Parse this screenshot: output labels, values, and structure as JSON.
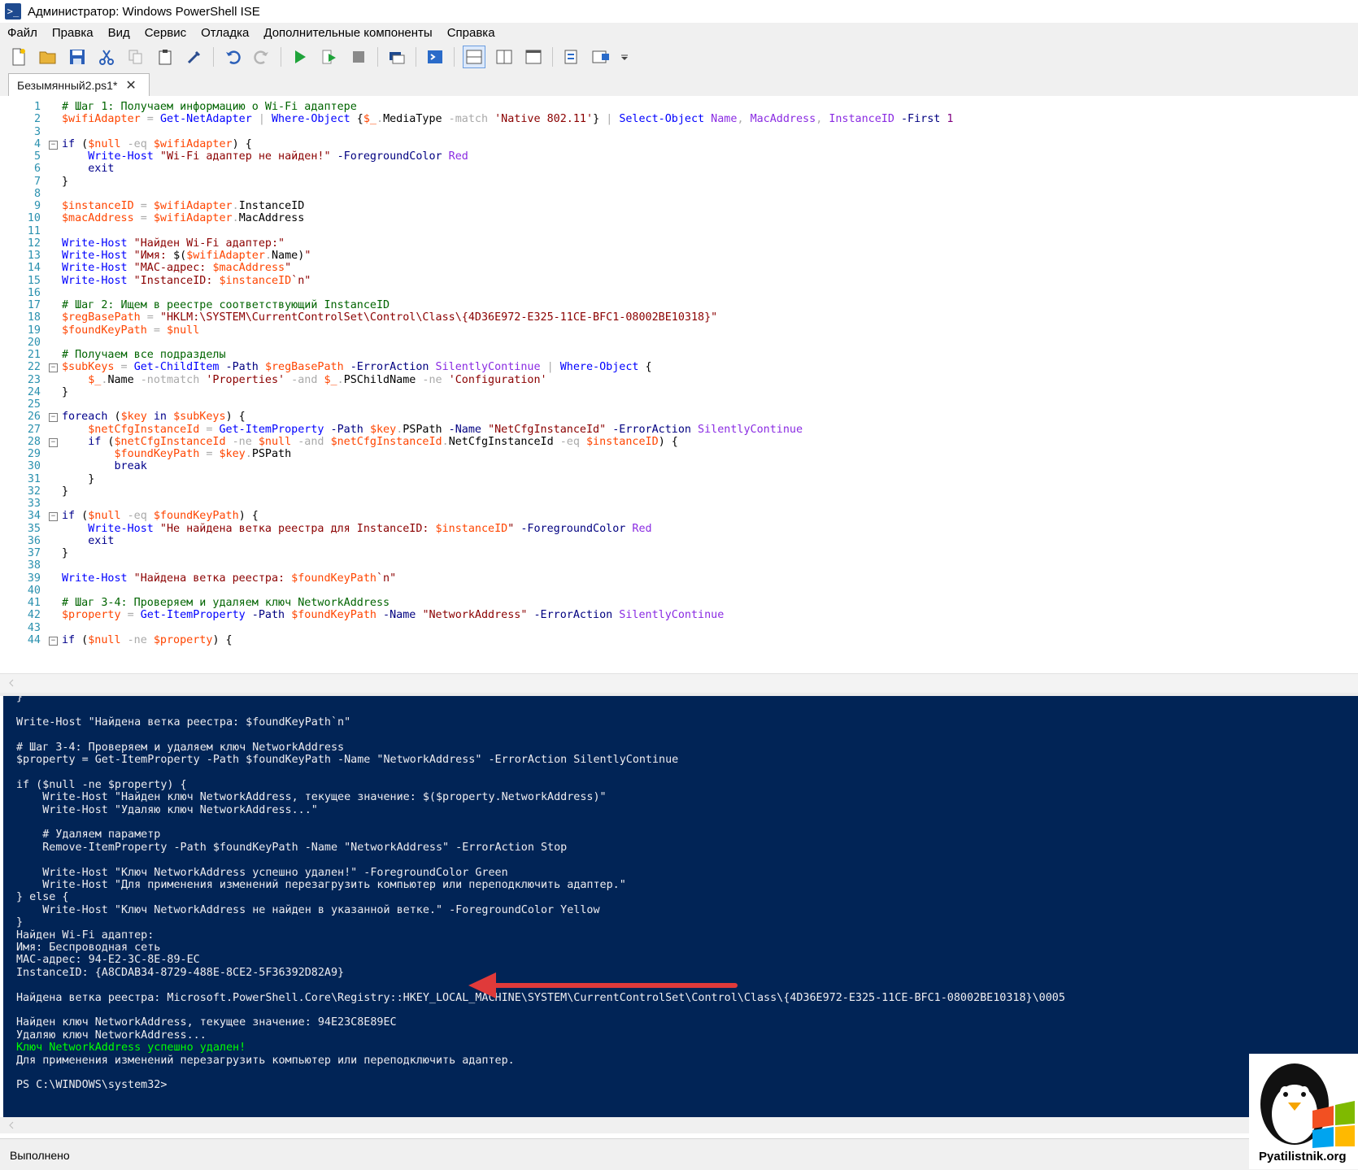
{
  "window": {
    "title": "Администратор: Windows PowerShell ISE"
  },
  "menu": [
    "Файл",
    "Правка",
    "Вид",
    "Сервис",
    "Отладка",
    "Дополнительные компоненты",
    "Справка"
  ],
  "toolbar": {
    "buttons": [
      "new-file-icon",
      "open-folder-icon",
      "save-icon",
      "cut-icon",
      "copy-icon",
      "paste-icon",
      "clear-icon",
      "undo-icon",
      "redo-icon",
      "run-icon",
      "run-selection-icon",
      "stop-icon",
      "remote-powershell-icon",
      "powershell-console-icon",
      "show-script-top-icon",
      "show-script-right-icon",
      "show-script-max-icon",
      "show-commands-icon",
      "show-addon-icon",
      "overflow-icon"
    ]
  },
  "tab": {
    "label": "Безымянный2.ps1*",
    "close": "✕"
  },
  "editor": {
    "lines": [
      {
        "n": "1",
        "fold": "",
        "t": [
          [
            "c-cm",
            "# Шаг 1: Получаем информацию о Wi-Fi адаптере"
          ]
        ]
      },
      {
        "n": "2",
        "fold": "",
        "t": [
          [
            "c-vr",
            "$wifiAdapter"
          ],
          [
            "c-op",
            " = "
          ],
          [
            "c-cmd",
            "Get-NetAdapter"
          ],
          [
            "c-op",
            " | "
          ],
          [
            "c-cmd",
            "Where-Object"
          ],
          [
            "c-pl",
            " {"
          ],
          [
            "c-vr",
            "$_"
          ],
          [
            "c-op",
            "."
          ],
          [
            "c-mem",
            "MediaType"
          ],
          [
            "c-op",
            " -match "
          ],
          [
            "c-str",
            "'Native 802.11'"
          ],
          [
            "c-pl",
            "} "
          ],
          [
            "c-op",
            "| "
          ],
          [
            "c-cmd",
            "Select-Object"
          ],
          [
            "c-arg",
            " Name"
          ],
          [
            "c-op",
            ", "
          ],
          [
            "c-arg",
            "MacAddress"
          ],
          [
            "c-op",
            ", "
          ],
          [
            "c-arg",
            "InstanceID"
          ],
          [
            "c-par",
            " -First"
          ],
          [
            "c-num",
            " 1"
          ]
        ]
      },
      {
        "n": "3",
        "fold": "",
        "t": []
      },
      {
        "n": "4",
        "fold": "−",
        "t": [
          [
            "c-kw",
            "if"
          ],
          [
            "c-pl",
            " ("
          ],
          [
            "c-vr",
            "$null"
          ],
          [
            "c-op",
            " -eq "
          ],
          [
            "c-vr",
            "$wifiAdapter"
          ],
          [
            "c-pl",
            ") {"
          ]
        ]
      },
      {
        "n": "5",
        "fold": "",
        "t": [
          [
            "c-pl",
            "    "
          ],
          [
            "c-cmd",
            "Write-Host"
          ],
          [
            "c-str",
            " \"Wi-Fi адаптер не найден!\""
          ],
          [
            "c-par",
            " -ForegroundColor"
          ],
          [
            "c-arg",
            " Red"
          ]
        ]
      },
      {
        "n": "6",
        "fold": "",
        "t": [
          [
            "c-pl",
            "    "
          ],
          [
            "c-kw",
            "exit"
          ]
        ]
      },
      {
        "n": "7",
        "fold": "",
        "t": [
          [
            "c-pl",
            "}"
          ]
        ]
      },
      {
        "n": "8",
        "fold": "",
        "t": []
      },
      {
        "n": "9",
        "fold": "",
        "t": [
          [
            "c-vr",
            "$instanceID"
          ],
          [
            "c-op",
            " = "
          ],
          [
            "c-vr",
            "$wifiAdapter"
          ],
          [
            "c-op",
            "."
          ],
          [
            "c-mem",
            "InstanceID"
          ]
        ]
      },
      {
        "n": "10",
        "fold": "",
        "t": [
          [
            "c-vr",
            "$macAddress"
          ],
          [
            "c-op",
            " = "
          ],
          [
            "c-vr",
            "$wifiAdapter"
          ],
          [
            "c-op",
            "."
          ],
          [
            "c-mem",
            "MacAddress"
          ]
        ]
      },
      {
        "n": "11",
        "fold": "",
        "t": []
      },
      {
        "n": "12",
        "fold": "",
        "t": [
          [
            "c-cmd",
            "Write-Host"
          ],
          [
            "c-str",
            " \"Найден Wi-Fi адаптер:\""
          ]
        ]
      },
      {
        "n": "13",
        "fold": "",
        "t": [
          [
            "c-cmd",
            "Write-Host"
          ],
          [
            "c-str",
            " \"Имя: "
          ],
          [
            "c-pl",
            "$("
          ],
          [
            "c-vr",
            "$wifiAdapter"
          ],
          [
            "c-op",
            "."
          ],
          [
            "c-mem",
            "Name"
          ],
          [
            "c-pl",
            ")"
          ],
          [
            "c-str",
            "\""
          ]
        ]
      },
      {
        "n": "14",
        "fold": "",
        "t": [
          [
            "c-cmd",
            "Write-Host"
          ],
          [
            "c-str",
            " \"MAC-адрес: "
          ],
          [
            "c-vr",
            "$macAddress"
          ],
          [
            "c-str",
            "\""
          ]
        ]
      },
      {
        "n": "15",
        "fold": "",
        "t": [
          [
            "c-cmd",
            "Write-Host"
          ],
          [
            "c-str",
            " \"InstanceID: "
          ],
          [
            "c-vr",
            "$instanceID"
          ],
          [
            "c-str",
            "`n\""
          ]
        ]
      },
      {
        "n": "16",
        "fold": "",
        "t": []
      },
      {
        "n": "17",
        "fold": "",
        "t": [
          [
            "c-cm",
            "# Шаг 2: Ищем в реестре соответствующий InstanceID"
          ]
        ]
      },
      {
        "n": "18",
        "fold": "",
        "t": [
          [
            "c-vr",
            "$regBasePath"
          ],
          [
            "c-op",
            " = "
          ],
          [
            "c-str",
            "\"HKLM:\\SYSTEM\\CurrentControlSet\\Control\\Class\\{4D36E972-E325-11CE-BFC1-08002BE10318}\""
          ]
        ]
      },
      {
        "n": "19",
        "fold": "",
        "t": [
          [
            "c-vr",
            "$foundKeyPath"
          ],
          [
            "c-op",
            " = "
          ],
          [
            "c-vr",
            "$null"
          ]
        ]
      },
      {
        "n": "20",
        "fold": "",
        "t": []
      },
      {
        "n": "21",
        "fold": "",
        "t": [
          [
            "c-cm",
            "# Получаем все подразделы"
          ]
        ]
      },
      {
        "n": "22",
        "fold": "−",
        "t": [
          [
            "c-vr",
            "$subKeys"
          ],
          [
            "c-op",
            " = "
          ],
          [
            "c-cmd",
            "Get-ChildItem"
          ],
          [
            "c-par",
            " -Path "
          ],
          [
            "c-vr",
            "$regBasePath"
          ],
          [
            "c-par",
            " -ErrorAction"
          ],
          [
            "c-arg",
            " SilentlyContinue"
          ],
          [
            "c-op",
            " | "
          ],
          [
            "c-cmd",
            "Where-Object"
          ],
          [
            "c-pl",
            " {"
          ]
        ]
      },
      {
        "n": "23",
        "fold": "",
        "t": [
          [
            "c-pl",
            "    "
          ],
          [
            "c-vr",
            "$_"
          ],
          [
            "c-op",
            "."
          ],
          [
            "c-mem",
            "Name"
          ],
          [
            "c-op",
            " -notmatch "
          ],
          [
            "c-str",
            "'Properties'"
          ],
          [
            "c-op",
            " -and "
          ],
          [
            "c-vr",
            "$_"
          ],
          [
            "c-op",
            "."
          ],
          [
            "c-mem",
            "PSChildName"
          ],
          [
            "c-op",
            " -ne "
          ],
          [
            "c-str",
            "'Configuration'"
          ]
        ]
      },
      {
        "n": "24",
        "fold": "",
        "t": [
          [
            "c-pl",
            "}"
          ]
        ]
      },
      {
        "n": "25",
        "fold": "",
        "t": []
      },
      {
        "n": "26",
        "fold": "−",
        "t": [
          [
            "c-kw",
            "foreach"
          ],
          [
            "c-pl",
            " ("
          ],
          [
            "c-vr",
            "$key"
          ],
          [
            "c-kw",
            " in "
          ],
          [
            "c-vr",
            "$subKeys"
          ],
          [
            "c-pl",
            ") {"
          ]
        ]
      },
      {
        "n": "27",
        "fold": "",
        "t": [
          [
            "c-pl",
            "    "
          ],
          [
            "c-vr",
            "$netCfgInstanceId"
          ],
          [
            "c-op",
            " = "
          ],
          [
            "c-cmd",
            "Get-ItemProperty"
          ],
          [
            "c-par",
            " -Path "
          ],
          [
            "c-vr",
            "$key"
          ],
          [
            "c-op",
            "."
          ],
          [
            "c-mem",
            "PSPath"
          ],
          [
            "c-par",
            " -Name "
          ],
          [
            "c-str",
            "\"NetCfgInstanceId\""
          ],
          [
            "c-par",
            " -ErrorAction"
          ],
          [
            "c-arg",
            " SilentlyContinue"
          ]
        ]
      },
      {
        "n": "28",
        "fold": "−",
        "t": [
          [
            "c-pl",
            "    "
          ],
          [
            "c-kw",
            "if"
          ],
          [
            "c-pl",
            " ("
          ],
          [
            "c-vr",
            "$netCfgInstanceId"
          ],
          [
            "c-op",
            " -ne "
          ],
          [
            "c-vr",
            "$null"
          ],
          [
            "c-op",
            " -and "
          ],
          [
            "c-vr",
            "$netCfgInstanceId"
          ],
          [
            "c-op",
            "."
          ],
          [
            "c-mem",
            "NetCfgInstanceId"
          ],
          [
            "c-op",
            " -eq "
          ],
          [
            "c-vr",
            "$instanceID"
          ],
          [
            "c-pl",
            ") {"
          ]
        ]
      },
      {
        "n": "29",
        "fold": "",
        "t": [
          [
            "c-pl",
            "        "
          ],
          [
            "c-vr",
            "$foundKeyPath"
          ],
          [
            "c-op",
            " = "
          ],
          [
            "c-vr",
            "$key"
          ],
          [
            "c-op",
            "."
          ],
          [
            "c-mem",
            "PSPath"
          ]
        ]
      },
      {
        "n": "30",
        "fold": "",
        "t": [
          [
            "c-pl",
            "        "
          ],
          [
            "c-kw",
            "break"
          ]
        ]
      },
      {
        "n": "31",
        "fold": "",
        "t": [
          [
            "c-pl",
            "    }"
          ]
        ]
      },
      {
        "n": "32",
        "fold": "",
        "t": [
          [
            "c-pl",
            "}"
          ]
        ]
      },
      {
        "n": "33",
        "fold": "",
        "t": []
      },
      {
        "n": "34",
        "fold": "−",
        "t": [
          [
            "c-kw",
            "if"
          ],
          [
            "c-pl",
            " ("
          ],
          [
            "c-vr",
            "$null"
          ],
          [
            "c-op",
            " -eq "
          ],
          [
            "c-vr",
            "$foundKeyPath"
          ],
          [
            "c-pl",
            ") {"
          ]
        ]
      },
      {
        "n": "35",
        "fold": "",
        "t": [
          [
            "c-pl",
            "    "
          ],
          [
            "c-cmd",
            "Write-Host"
          ],
          [
            "c-str",
            " \"Не найдена ветка реестра для InstanceID: "
          ],
          [
            "c-vr",
            "$instanceID"
          ],
          [
            "c-str",
            "\""
          ],
          [
            "c-par",
            " -ForegroundColor"
          ],
          [
            "c-arg",
            " Red"
          ]
        ]
      },
      {
        "n": "36",
        "fold": "",
        "t": [
          [
            "c-pl",
            "    "
          ],
          [
            "c-kw",
            "exit"
          ]
        ]
      },
      {
        "n": "37",
        "fold": "",
        "t": [
          [
            "c-pl",
            "}"
          ]
        ]
      },
      {
        "n": "38",
        "fold": "",
        "t": []
      },
      {
        "n": "39",
        "fold": "",
        "t": [
          [
            "c-cmd",
            "Write-Host"
          ],
          [
            "c-str",
            " \"Найдена ветка реестра: "
          ],
          [
            "c-vr",
            "$foundKeyPath"
          ],
          [
            "c-str",
            "`n\""
          ]
        ]
      },
      {
        "n": "40",
        "fold": "",
        "t": []
      },
      {
        "n": "41",
        "fold": "",
        "t": [
          [
            "c-cm",
            "# Шаг 3-4: Проверяем и удаляем ключ NetworkAddress"
          ]
        ]
      },
      {
        "n": "42",
        "fold": "",
        "t": [
          [
            "c-vr",
            "$property"
          ],
          [
            "c-op",
            " = "
          ],
          [
            "c-cmd",
            "Get-ItemProperty"
          ],
          [
            "c-par",
            " -Path "
          ],
          [
            "c-vr",
            "$foundKeyPath"
          ],
          [
            "c-par",
            " -Name "
          ],
          [
            "c-str",
            "\"NetworkAddress\""
          ],
          [
            "c-par",
            " -ErrorAction"
          ],
          [
            "c-arg",
            " SilentlyContinue"
          ]
        ]
      },
      {
        "n": "43",
        "fold": "",
        "t": []
      },
      {
        "n": "44",
        "fold": "−",
        "t": [
          [
            "c-kw",
            "if"
          ],
          [
            "c-pl",
            " ("
          ],
          [
            "c-vr",
            "$null"
          ],
          [
            "c-op",
            " -ne "
          ],
          [
            "c-vr",
            "$property"
          ],
          [
            "c-pl",
            ") {"
          ]
        ]
      }
    ]
  },
  "console": {
    "lines": [
      {
        "t": "}",
        "c": ""
      },
      {
        "t": "",
        "c": ""
      },
      {
        "t": "Write-Host \"Найдена ветка реестра: $foundKeyPath`n\"",
        "c": ""
      },
      {
        "t": "",
        "c": ""
      },
      {
        "t": "# Шаг 3-4: Проверяем и удаляем ключ NetworkAddress",
        "c": ""
      },
      {
        "t": "$property = Get-ItemProperty -Path $foundKeyPath -Name \"NetworkAddress\" -ErrorAction SilentlyContinue",
        "c": ""
      },
      {
        "t": "",
        "c": ""
      },
      {
        "t": "if ($null -ne $property) {",
        "c": ""
      },
      {
        "t": "    Write-Host \"Найден ключ NetworkAddress, текущее значение: $($property.NetworkAddress)\"",
        "c": ""
      },
      {
        "t": "    Write-Host \"Удаляю ключ NetworkAddress...\"",
        "c": ""
      },
      {
        "t": "",
        "c": ""
      },
      {
        "t": "    # Удаляем параметр",
        "c": ""
      },
      {
        "t": "    Remove-ItemProperty -Path $foundKeyPath -Name \"NetworkAddress\" -ErrorAction Stop",
        "c": ""
      },
      {
        "t": "",
        "c": ""
      },
      {
        "t": "    Write-Host \"Ключ NetworkAddress успешно удален!\" -ForegroundColor Green",
        "c": ""
      },
      {
        "t": "    Write-Host \"Для применения изменений перезагрузить компьютер или переподключить адаптер.\"",
        "c": ""
      },
      {
        "t": "} else {",
        "c": ""
      },
      {
        "t": "    Write-Host \"Ключ NetworkAddress не найден в указанной ветке.\" -ForegroundColor Yellow",
        "c": ""
      },
      {
        "t": "}",
        "c": ""
      },
      {
        "t": "Найден Wi-Fi адаптер:",
        "c": ""
      },
      {
        "t": "Имя: Беспроводная сеть",
        "c": ""
      },
      {
        "t": "MAC-адрес: 94-E2-3C-8E-89-EC",
        "c": ""
      },
      {
        "t": "InstanceID: {A8CDAB34-8729-488E-8CE2-5F36392D82A9}",
        "c": ""
      },
      {
        "t": "",
        "c": ""
      },
      {
        "t": "Найдена ветка реестра: Microsoft.PowerShell.Core\\Registry::HKEY_LOCAL_MACHINE\\SYSTEM\\CurrentControlSet\\Control\\Class\\{4D36E972-E325-11CE-BFC1-08002BE10318}\\0005",
        "c": ""
      },
      {
        "t": "",
        "c": ""
      },
      {
        "t": "Найден ключ NetworkAddress, текущее значение: 94E23C8E89EC",
        "c": ""
      },
      {
        "t": "Удаляю ключ NetworkAddress...",
        "c": ""
      },
      {
        "t": "Ключ NetworkAddress успешно удален!",
        "c": "green"
      },
      {
        "t": "Для применения изменений перезагрузить компьютер или переподключить адаптер.",
        "c": ""
      },
      {
        "t": "",
        "c": ""
      },
      {
        "t": "PS C:\\WINDOWS\\system32>",
        "c": ""
      }
    ]
  },
  "status": {
    "text": "Выполнено"
  },
  "watermark": {
    "text": "Pyatilistnik.org"
  },
  "colors": {
    "console_bg": "#012456",
    "arrow": "#e03a3a",
    "success": "#00ff00"
  }
}
